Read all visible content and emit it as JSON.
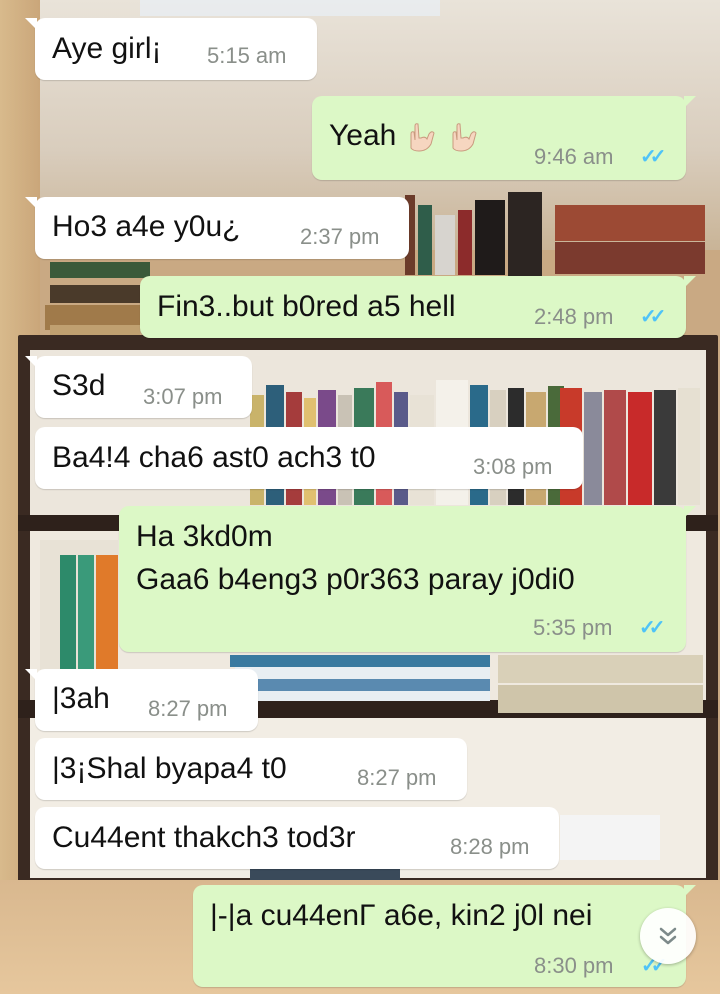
{
  "messages": [
    {
      "dir": "in",
      "text": "Aye girl¡",
      "time": "5:15 am"
    },
    {
      "dir": "out",
      "text": "Yeah",
      "emoji": "hand-sign-emoji",
      "time": "9:46 am",
      "ticks": "✓✓"
    },
    {
      "dir": "in",
      "text": "Ho3 a4e y0u¿",
      "time": "2:37 pm"
    },
    {
      "dir": "out",
      "text": "Fin3..but b0red a5 hell",
      "time": "2:48 pm",
      "ticks": "✓✓"
    },
    {
      "dir": "in",
      "text": "S3d",
      "time": "3:07 pm"
    },
    {
      "dir": "in",
      "text": "Ba4!4 cha6 ast0 ach3 t0",
      "time": "3:08 pm"
    },
    {
      "dir": "out",
      "text_line1": "Ha 3kd0m",
      "text_line2": "Gaa6 b4eng3 p0r363 paray j0di0",
      "time": "5:35 pm",
      "ticks": "✓✓"
    },
    {
      "dir": "in",
      "text": "|3ah",
      "time": "8:27 pm"
    },
    {
      "dir": "in",
      "text": "|3¡Shal byapa4 t0",
      "time": "8:27 pm"
    },
    {
      "dir": "in",
      "text": "Cu44ent thakch3 tod3r",
      "time": "8:28 pm"
    },
    {
      "dir": "out",
      "text": "|-|a cu44enΓ a6e, kin2 j0l nei",
      "time": "8:30 pm",
      "ticks": "✓✓"
    }
  ],
  "scroll_button": {
    "icon": "double-chevron-down-icon"
  },
  "colors": {
    "incoming": "#ffffff",
    "outgoing": "#dcf8c6",
    "read_ticks": "#4fc3f7",
    "timestamp": "#8a8f8a"
  }
}
